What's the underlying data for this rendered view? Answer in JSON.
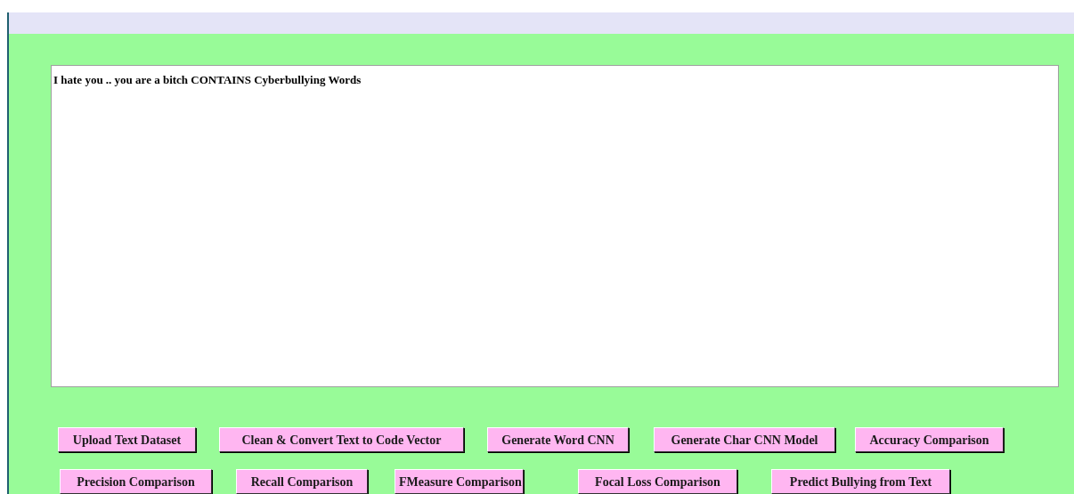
{
  "output_text": "I hate you .. you are a bitch CONTAINS Cyberbullying Words",
  "button_rows": [
    [
      "Upload Text Dataset",
      "Clean & Convert Text to Code Vector",
      "Generate Word CNN",
      "Generate Char CNN Model",
      "Accuracy Comparison"
    ],
    [
      "Precision Comparison",
      "Recall Comparison",
      "FMeasure Comparison",
      "Focal Loss Comparison",
      "Predict Bullying from Text"
    ]
  ]
}
